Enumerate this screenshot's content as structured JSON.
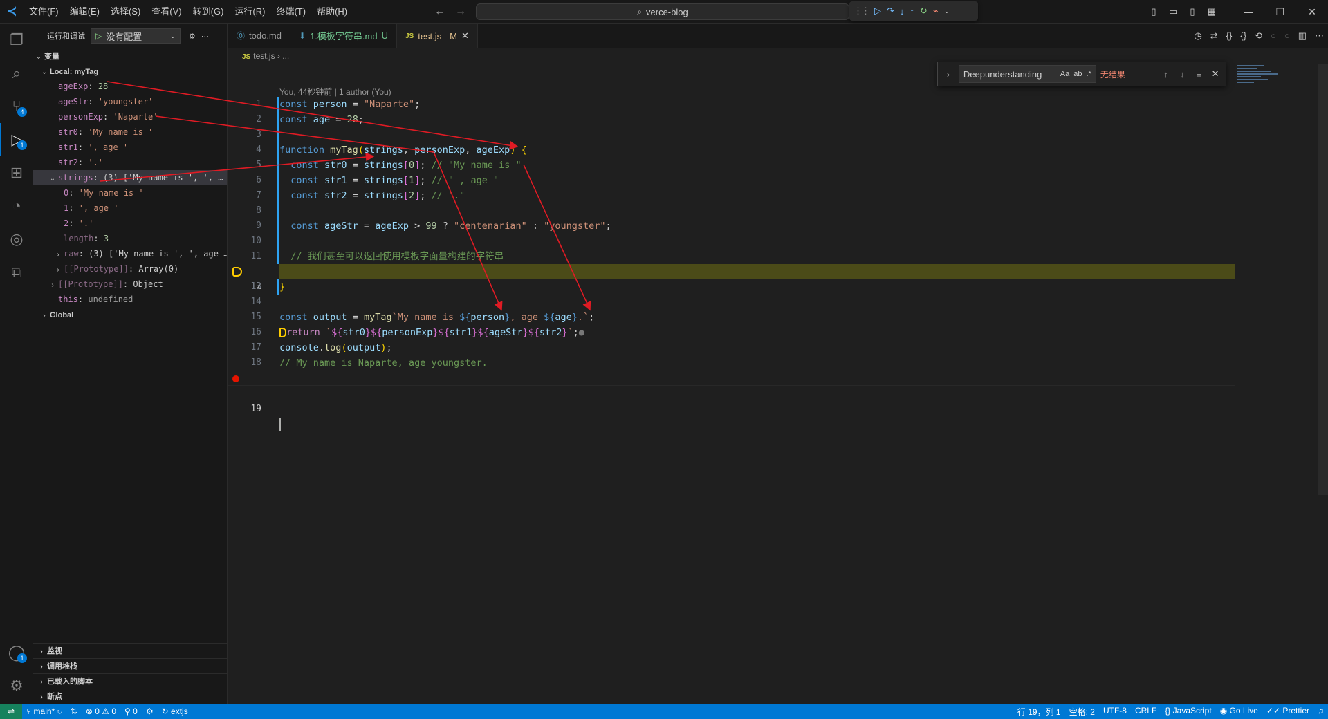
{
  "titlebar": {
    "menus": [
      "文件(F)",
      "编辑(E)",
      "选择(S)",
      "查看(V)",
      "转到(G)",
      "运行(R)",
      "终端(T)",
      "帮助(H)"
    ],
    "search_text": "verce-blog"
  },
  "sidebar": {
    "header_title": "运行和调试",
    "config_value": "没有配置",
    "variables_title": "变量",
    "scope_local": "Local: myTag",
    "vars": [
      {
        "name": "ageExp",
        "value": "28"
      },
      {
        "name": "ageStr",
        "value": "'youngster'"
      },
      {
        "name": "personExp",
        "value": "'Naparte'"
      },
      {
        "name": "str0",
        "value": "'My name is '"
      },
      {
        "name": "str1",
        "value": "', age '"
      },
      {
        "name": "str2",
        "value": "'.'"
      }
    ],
    "strings_var": {
      "name": "strings",
      "value": "(3) ['My name is ', ', …"
    },
    "strings_children": [
      {
        "name": "0",
        "value": "'My name is '"
      },
      {
        "name": "1",
        "value": "', age '"
      },
      {
        "name": "2",
        "value": "'.'"
      },
      {
        "name": "length",
        "value": "3"
      }
    ],
    "raw_var": {
      "name": "raw",
      "value": "(3) ['My name is ', ', age …"
    },
    "proto_array": {
      "name": "[[Prototype]]",
      "value": "Array(0)"
    },
    "proto_object": {
      "name": "[[Prototype]]",
      "value": "Object"
    },
    "this_var": {
      "name": "this",
      "value": "undefined"
    },
    "scope_global": "Global",
    "bottom_sections": [
      "监视",
      "调用堆栈",
      "已载入的脚本",
      "断点"
    ]
  },
  "tabs": [
    {
      "label": "todo.md",
      "icon": "markdown-icon",
      "modifier": ""
    },
    {
      "label": "1.模板字符串.md",
      "icon": "markdown-icon",
      "modifier": "U"
    },
    {
      "label": "test.js",
      "icon": "js-icon",
      "modifier": "M",
      "active": true
    }
  ],
  "breadcrumb": {
    "file": "test.js",
    "more": "..."
  },
  "editor": {
    "codelens": "You, 44秒钟前 | 1 author (You)",
    "current_line": "19"
  },
  "find": {
    "value": "Deepunderstanding",
    "opt_case": "Aa",
    "opt_word": "ab",
    "opt_regex": ".*",
    "result": "无结果"
  },
  "statusbar": {
    "branch": "main*",
    "errors": "0",
    "warnings": "0",
    "ports": "0",
    "extjs": "extjs",
    "position": "行 19，列 1",
    "spaces": "空格: 2",
    "encoding": "UTF-8",
    "eol": "CRLF",
    "language": "JavaScript",
    "golive": "Go Live",
    "prettier": "Prettier"
  },
  "colors": {
    "accent": "#0078d4",
    "highlight_line": "#4b4b18",
    "breakpoint": "#e51400",
    "annotation_arrow": "#e01b24"
  }
}
